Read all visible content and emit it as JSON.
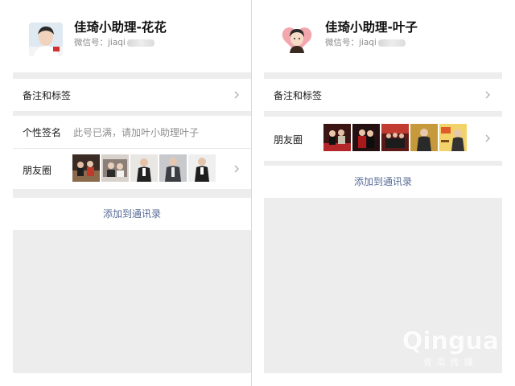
{
  "left": {
    "name": "佳琦小助理-花花",
    "wechat_id_prefix": "微信号：jiaqi",
    "remarks_label": "备注和标签",
    "signature_label": "个性签名",
    "signature_value": "此号已满，请加叶小助理叶子",
    "moments_label": "朋友圈",
    "moments_thumbs": [
      "photo-1",
      "photo-2",
      "photo-3",
      "photo-4",
      "photo-5"
    ],
    "add_contact": "添加到通讯录"
  },
  "right": {
    "name": "佳琦小助理-叶子",
    "wechat_id_prefix": "微信号：jiaqi",
    "remarks_label": "备注和标签",
    "moments_label": "朋友圈",
    "moments_thumbs": [
      "photo-1",
      "photo-2",
      "photo-3",
      "photo-4",
      "photo-5"
    ],
    "add_contact": "添加到通讯录"
  },
  "watermark": {
    "logo": "Qingua",
    "sub": "青瓜传媒"
  },
  "colors": {
    "link": "#576b95",
    "background": "#ededed",
    "card": "#ffffff"
  }
}
